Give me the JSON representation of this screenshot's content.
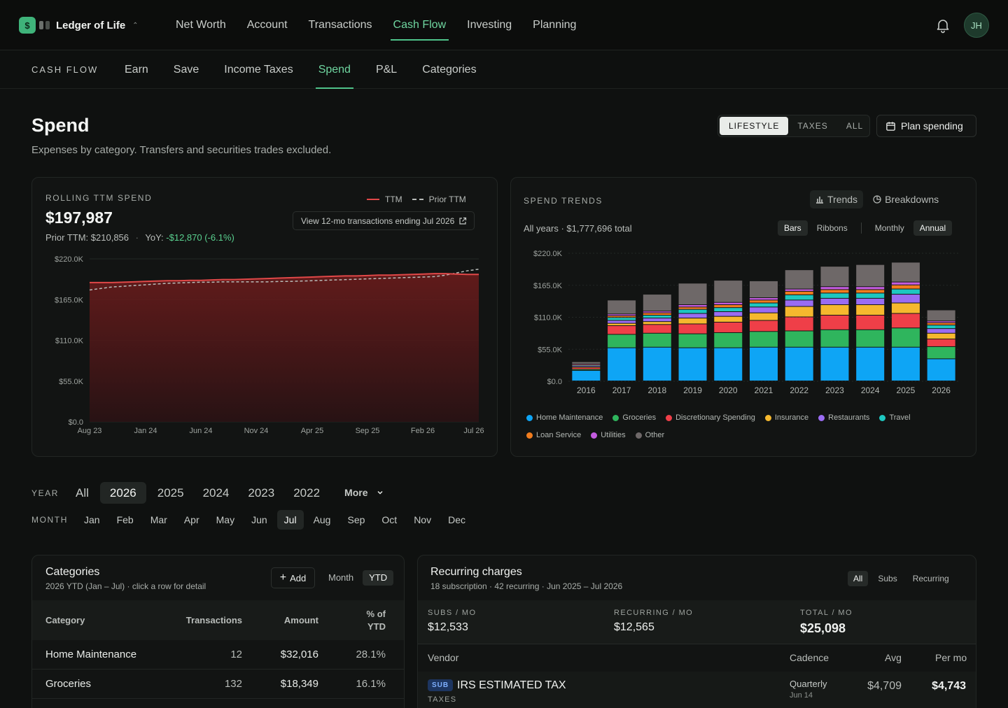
{
  "brand": {
    "name": "Ledger of Life",
    "logo_glyph": "$"
  },
  "topnav": [
    {
      "label": "Net Worth"
    },
    {
      "label": "Account"
    },
    {
      "label": "Transactions"
    },
    {
      "label": "Cash Flow",
      "active": true
    },
    {
      "label": "Investing"
    },
    {
      "label": "Planning"
    }
  ],
  "user": {
    "initials": "JH"
  },
  "subnav": {
    "section": "CASH FLOW",
    "items": [
      {
        "label": "Earn"
      },
      {
        "label": "Save"
      },
      {
        "label": "Income Taxes"
      },
      {
        "label": "Spend",
        "active": true
      },
      {
        "label": "P&L"
      },
      {
        "label": "Categories"
      }
    ]
  },
  "page": {
    "title": "Spend",
    "subtitle": "Expenses by category. Transfers and securities trades excluded.",
    "filter": {
      "options": [
        "LIFESTYLE",
        "TAXES",
        "ALL"
      ],
      "selected": "LIFESTYLE"
    },
    "plan_button": "Plan spending"
  },
  "ttm": {
    "label": "ROLLING TTM SPEND",
    "value": "$197,987",
    "prior_label": "Prior TTM:",
    "prior_value": "$210,856",
    "yoy_label": "YoY:",
    "yoy_value": "-$12,870 (-6.1%)",
    "legend_ttm": "TTM",
    "legend_prior": "Prior TTM",
    "view_button": "View 12-mo transactions ending Jul 2026",
    "colors": {
      "ttm": "#e04848",
      "prior": "#b9bdba"
    }
  },
  "trends": {
    "label": "SPEND TRENDS",
    "tabs": [
      {
        "label": "Trends",
        "active": true
      },
      {
        "label": "Breakdowns"
      }
    ],
    "total": "All years · $1,777,696 total",
    "view_options": [
      {
        "label": "Bars",
        "active": true
      },
      {
        "label": "Ribbons"
      }
    ],
    "period_options": [
      {
        "label": "Monthly"
      },
      {
        "label": "Annual",
        "active": true
      }
    ]
  },
  "chart_data": [
    {
      "type": "area",
      "x_ticks": [
        "Aug 23",
        "Jan 24",
        "Jun 24",
        "Nov 24",
        "Apr 25",
        "Sep 25",
        "Feb 26",
        "Jul 26"
      ],
      "y_ticks": [
        "$220.0K",
        "$165.0K",
        "$110.0K",
        "$55.0K",
        "$0.0"
      ],
      "ylim": [
        0,
        220000
      ],
      "series": [
        {
          "name": "TTM",
          "values": [
            188000,
            188000,
            188000,
            188500,
            189000,
            189500,
            190000,
            190500,
            190500,
            191000,
            191000,
            191500,
            192000,
            192000,
            192500,
            193000,
            193500,
            194000,
            194500,
            195000,
            195500,
            196000,
            196500,
            197000,
            197000,
            197500,
            198000,
            198000,
            198500,
            199000,
            199500,
            200000,
            200000,
            199500,
            199000,
            199000
          ]
        },
        {
          "name": "Prior TTM",
          "values": [
            178000,
            180000,
            182000,
            183000,
            184000,
            185000,
            186000,
            187000,
            187500,
            188000,
            188500,
            188500,
            189000,
            189000,
            189000,
            189000,
            189000,
            189500,
            189500,
            190000,
            190500,
            191000,
            191500,
            192000,
            192500,
            193000,
            193500,
            194000,
            194500,
            195000,
            195500,
            196000,
            198000,
            201000,
            204000,
            206000
          ]
        }
      ]
    },
    {
      "type": "bar",
      "stacked": true,
      "categories": [
        "2016",
        "2017",
        "2018",
        "2019",
        "2020",
        "2021",
        "2022",
        "2023",
        "2024",
        "2025",
        "2026"
      ],
      "y_ticks": [
        "$220.0K",
        "$165.0K",
        "$110.0K",
        "$55.0K",
        "$0.0"
      ],
      "ylim": [
        0,
        220000
      ],
      "series": [
        {
          "name": "Home Maintenance",
          "color": "#0ea5f5",
          "values": [
            18000,
            57000,
            58000,
            57000,
            57000,
            58000,
            58000,
            58000,
            58000,
            58000,
            38000
          ]
        },
        {
          "name": "Groceries",
          "color": "#2fb55d",
          "values": [
            2000,
            23000,
            24000,
            24000,
            26000,
            27000,
            28000,
            30000,
            30000,
            33000,
            21000
          ]
        },
        {
          "name": "Discretionary Spending",
          "color": "#ef3f48",
          "values": [
            3000,
            15000,
            15000,
            17000,
            18000,
            19000,
            24000,
            25000,
            25000,
            25000,
            13000
          ]
        },
        {
          "name": "Insurance",
          "color": "#f5b82e",
          "values": [
            1000,
            4000,
            5000,
            10000,
            10000,
            13000,
            18000,
            18000,
            18000,
            18000,
            10000
          ]
        },
        {
          "name": "Restaurants",
          "color": "#9a6cf2",
          "values": [
            2000,
            5000,
            6000,
            8000,
            8000,
            10000,
            11000,
            11000,
            11000,
            15000,
            8000
          ]
        },
        {
          "name": "Travel",
          "color": "#1ec7c0",
          "values": [
            1000,
            5000,
            5000,
            7000,
            7000,
            7000,
            9000,
            9000,
            9000,
            9000,
            6000
          ]
        },
        {
          "name": "Loan Service",
          "color": "#f07c1e",
          "values": [
            1000,
            3000,
            4000,
            4000,
            5000,
            5000,
            6000,
            6000,
            6000,
            7000,
            4000
          ]
        },
        {
          "name": "Utilities",
          "color": "#c45ce0",
          "values": [
            1000,
            3000,
            3000,
            4000,
            4000,
            4000,
            4000,
            5000,
            5000,
            5000,
            3000
          ]
        },
        {
          "name": "Other",
          "color": "#6e6868",
          "values": [
            4000,
            24000,
            29000,
            37000,
            38000,
            29000,
            33000,
            35000,
            38000,
            34000,
            19000
          ]
        }
      ]
    }
  ],
  "period": {
    "year_label": "YEAR",
    "years": [
      {
        "label": "All"
      },
      {
        "label": "2026",
        "active": true
      },
      {
        "label": "2025"
      },
      {
        "label": "2024"
      },
      {
        "label": "2023"
      },
      {
        "label": "2022"
      }
    ],
    "more_label": "More",
    "month_label": "MONTH",
    "months": [
      {
        "label": "Jan"
      },
      {
        "label": "Feb"
      },
      {
        "label": "Mar"
      },
      {
        "label": "Apr"
      },
      {
        "label": "May"
      },
      {
        "label": "Jun"
      },
      {
        "label": "Jul",
        "active": true
      },
      {
        "label": "Aug"
      },
      {
        "label": "Sep"
      },
      {
        "label": "Oct"
      },
      {
        "label": "Nov"
      },
      {
        "label": "Dec"
      }
    ]
  },
  "categories": {
    "title": "Categories",
    "subtitle": "2026 YTD (Jan – Jul) · click a row for detail",
    "add_label": "Add",
    "toggle": [
      {
        "label": "Month"
      },
      {
        "label": "YTD",
        "active": true
      }
    ],
    "columns": [
      "Category",
      "Transactions",
      "Amount",
      "% of",
      "YTD"
    ],
    "rows": [
      {
        "name": "Home Maintenance",
        "count": "12",
        "amount": "$32,016",
        "pct": "28.1%"
      },
      {
        "name": "Groceries",
        "count": "132",
        "amount": "$18,349",
        "pct": "16.1%"
      }
    ]
  },
  "recurring": {
    "title": "Recurring charges",
    "subtitle": "18 subscription · 42 recurring · Jun 2025 – Jul 2026",
    "toggle": [
      {
        "label": "All",
        "active": true
      },
      {
        "label": "Subs"
      },
      {
        "label": "Recurring"
      }
    ],
    "stats": [
      {
        "label": "SUBS / MO",
        "value": "$12,533"
      },
      {
        "label": "RECURRING / MO",
        "value": "$12,565"
      },
      {
        "label": "TOTAL / MO",
        "value": "$25,098"
      }
    ],
    "columns": {
      "vendor": "Vendor",
      "cadence": "Cadence",
      "avg": "Avg",
      "per_mo": "Per mo"
    },
    "rows": [
      {
        "badge": "SUB",
        "vendor": "IRS ESTIMATED TAX",
        "category": "TAXES",
        "cadence": "Quarterly",
        "date": "Jun 14",
        "avg": "$4,709",
        "per_mo": "$4,743"
      }
    ]
  }
}
